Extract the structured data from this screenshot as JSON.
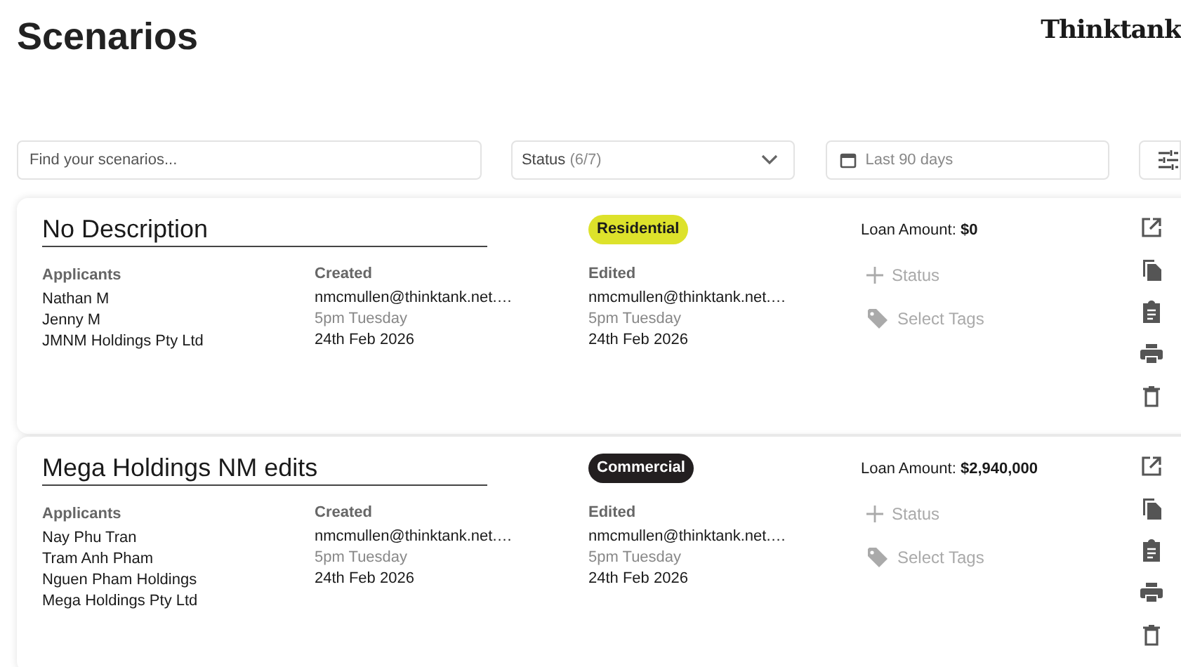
{
  "page": {
    "title": "Scenarios",
    "logo": "Thinktank"
  },
  "filters": {
    "search_placeholder": "Find your scenarios...",
    "status_label": "Status",
    "status_count": "(6/7)",
    "date_placeholder": "Last 90 days"
  },
  "scenarios": [
    {
      "title": "No Description",
      "tag": {
        "label": "Residential",
        "color": "#dde22b"
      },
      "loan_label": "Loan Amount:",
      "loan_amount": "$0",
      "applicants_label": "Applicants",
      "applicants": [
        "Nathan M",
        "Jenny M",
        "JMNM Holdings Pty Ltd"
      ],
      "created_label": "Created",
      "created": {
        "by": "nmcmullen@thinktank.net.…",
        "time": "5pm Tuesday",
        "date": "24th Feb 2026"
      },
      "edited_label": "Edited",
      "edited": {
        "by": "nmcmullen@thinktank.net.…",
        "time": "5pm Tuesday",
        "date": "24th Feb 2026"
      },
      "status_action": "Status",
      "tags_action": "Select Tags"
    },
    {
      "title": "Mega Holdings NM edits",
      "tag": {
        "label": "Commercial",
        "color": "#231f20"
      },
      "loan_label": "Loan Amount:",
      "loan_amount": "$2,940,000",
      "applicants_label": "Applicants",
      "applicants": [
        "Nay Phu Tran",
        "Tram Anh Pham",
        "Nguen Pham Holdings",
        "Mega Holdings Pty Ltd"
      ],
      "created_label": "Created",
      "created": {
        "by": "nmcmullen@thinktank.net.…",
        "time": "5pm Tuesday",
        "date": "24th Feb 2026"
      },
      "edited_label": "Edited",
      "edited": {
        "by": "nmcmullen@thinktank.net.…",
        "time": "5pm Tuesday",
        "date": "24th Feb 2026"
      },
      "status_action": "Status",
      "tags_action": "Select Tags"
    }
  ]
}
